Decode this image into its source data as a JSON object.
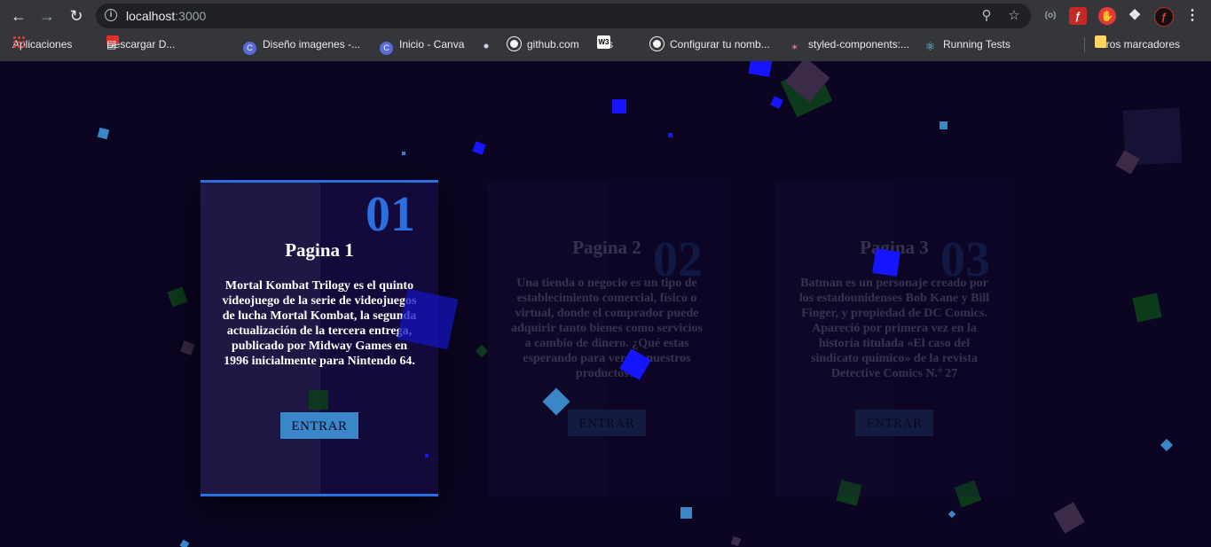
{
  "browser": {
    "url_host": "localhost",
    "url_port": ":3000",
    "bookmarks": [
      {
        "label": "Aplicaciones"
      },
      {
        "label": "Descargar D..."
      },
      {
        "label": "Diseño imagenes -..."
      },
      {
        "label": "Inicio - Canva"
      },
      {
        "label": ""
      },
      {
        "label": "github.com"
      },
      {
        "label": "css"
      },
      {
        "label": "Configurar tu nomb..."
      },
      {
        "label": "styled-components:..."
      },
      {
        "label": "Running Tests"
      }
    ],
    "other_bookmarks": "Otros marcadores"
  },
  "cards": [
    {
      "number": "01",
      "title": "Pagina 1",
      "text": "Mortal Kombat Trilogy es el quinto videojuego de la serie de videojuegos de lucha Mortal Kombat, la segunda actualización de la tercera entrega, publicado por Midway Games en 1996 inicialmente para Nintendo 64.",
      "button": "ENTRAR"
    },
    {
      "number": "02",
      "title": "Pagina 2",
      "text": "Una tienda o negocio es un tipo de establecimiento comercial, físico o virtual, donde el comprador puede adquirir tanto bienes como servicios a cambio de dinero. ¿Qué estas esperando para ver los nuestros productos?.",
      "button": "ENTRAR"
    },
    {
      "number": "03",
      "title": "Pagina 3",
      "text": "Batman es un personaje creado por los estadounidenses Bob Kane y Bill Finger, y propiedad de DC Comics. Apareció por primera vez en la historia titulada «El caso del sindicato químico» de la revista Detective Comics N.º 27",
      "button": "ENTRAR"
    }
  ],
  "colors": {
    "background": "#0b0522",
    "card": "#13093a",
    "accent": "#2b6fe0",
    "button": "#3a87c8"
  }
}
